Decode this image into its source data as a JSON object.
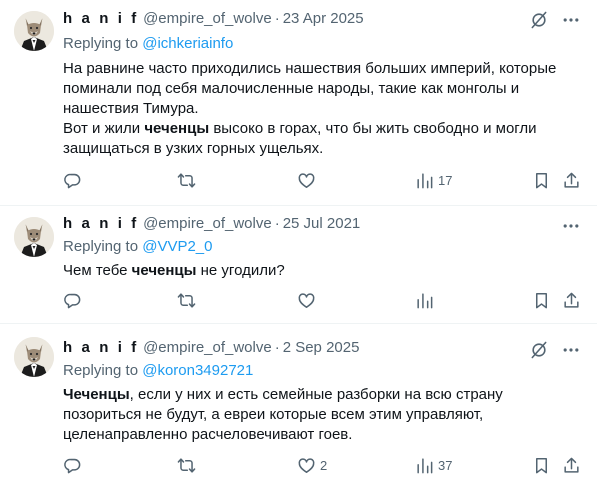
{
  "tweets": [
    {
      "name": "h a n i f",
      "handle": "@empire_of_wolve",
      "dot": "·",
      "date": "23 Apr 2025",
      "replying_prefix": "Replying to",
      "replying_to": "@ichkeriainfo",
      "body": {
        "p1": "На равнине часто приходились нашествия больших империй, которые поминали под себя малочисленные народы, такие как монголы и нашествия Тимура.",
        "p2_pre": "Вот и жили ",
        "p2_bold": "чеченцы",
        "p2_post": " высоко в горах, что бы жить свободно и могли защищаться в узких горных ущельях."
      },
      "reply_count": "",
      "retweet_count": "",
      "like_count": "",
      "views_count": "17"
    },
    {
      "name": "h a n i f",
      "handle": "@empire_of_wolve",
      "dot": "·",
      "date": "25 Jul 2021",
      "replying_prefix": "Replying to",
      "replying_to": "@VVP2_0",
      "body": {
        "pre": "Чем тебе ",
        "bold": "чеченцы",
        "post": " не угодили?"
      },
      "reply_count": "",
      "retweet_count": "",
      "like_count": "",
      "views_count": ""
    },
    {
      "name": "h a n i f",
      "handle": "@empire_of_wolve",
      "dot": "·",
      "date": "2 Sep 2025",
      "replying_prefix": "Replying to",
      "replying_to": "@koron3492721",
      "body": {
        "bold": "Чеченцы",
        "post": ", если у них и есть семейные разборки на всю страну позориться не будут, а евреи которые всем этим управляют, целенаправленно расчеловечивают  гоев."
      },
      "reply_count": "",
      "retweet_count": "",
      "like_count": "2",
      "views_count": "37"
    }
  ],
  "icons": {
    "grok": "grok-icon",
    "more": "more-icon",
    "reply": "reply-icon",
    "retweet": "retweet-icon",
    "like": "like-icon",
    "views": "views-icon",
    "bookmark": "bookmark-icon",
    "share": "share-icon"
  },
  "colors": {
    "text": "#0f1419",
    "secondary": "#536471",
    "link": "#1d9bf0",
    "divider": "#eff3f4"
  }
}
